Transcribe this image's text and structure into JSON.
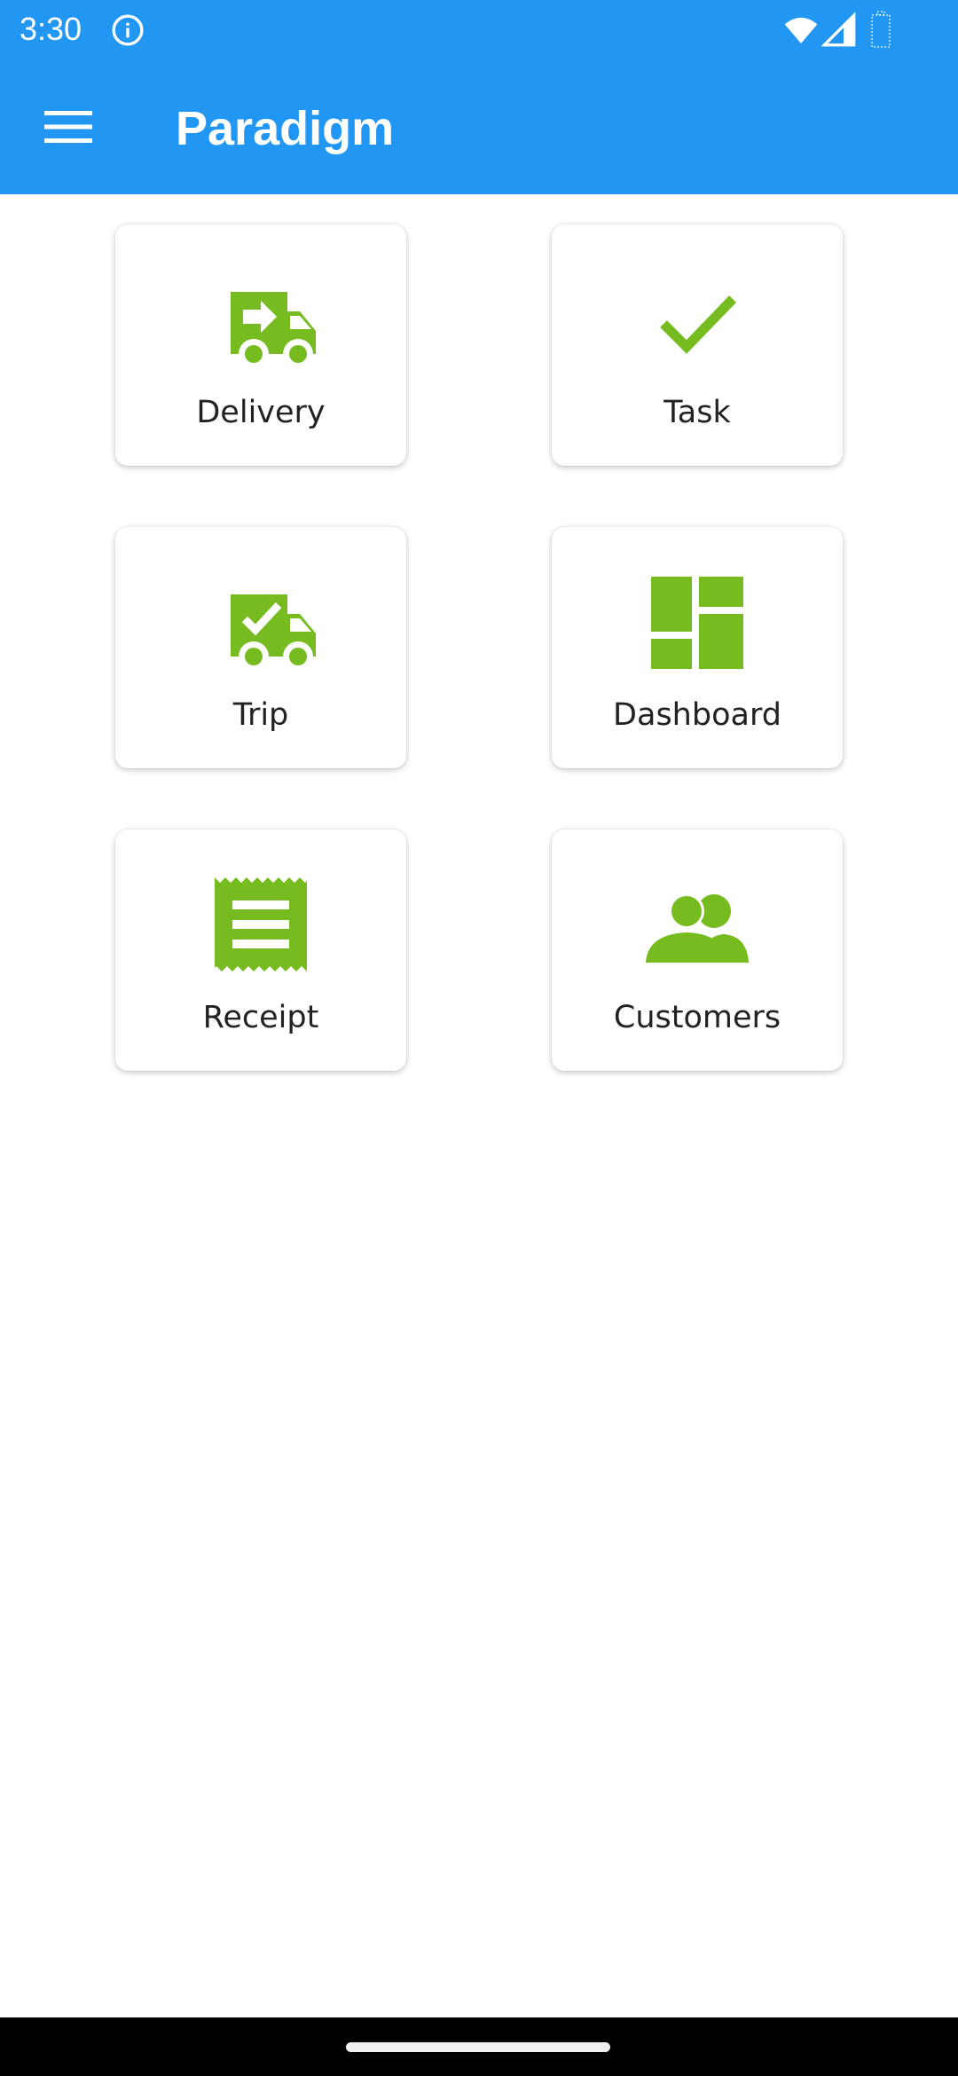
{
  "status_bar": {
    "time": "3:30",
    "icons": [
      "info-icon",
      "wifi-icon",
      "cellular-signal-icon",
      "battery-icon"
    ]
  },
  "app_bar": {
    "title": "Paradigm",
    "menu_icon": "hamburger-menu-icon"
  },
  "colors": {
    "app_bar": "#2196F3",
    "icon_accent": "#76BC21",
    "background": "#FFFFFF",
    "tile_label": "#222222"
  },
  "tiles": [
    {
      "label": "Delivery",
      "icon": "truck-arrow-icon"
    },
    {
      "label": "Task",
      "icon": "checkmark-icon"
    },
    {
      "label": "Trip",
      "icon": "truck-check-icon"
    },
    {
      "label": "Dashboard",
      "icon": "dashboard-icon"
    },
    {
      "label": "Receipt",
      "icon": "receipt-icon"
    },
    {
      "label": "Customers",
      "icon": "people-icon"
    }
  ]
}
